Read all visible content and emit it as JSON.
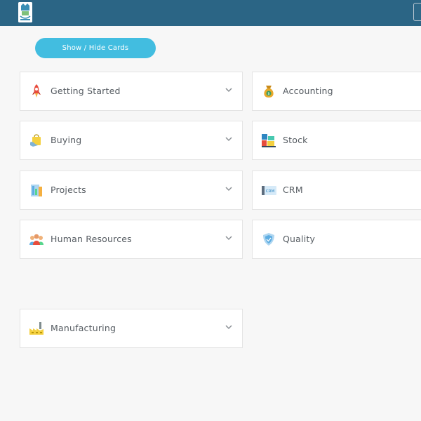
{
  "topbar": {
    "logo": "app-logo-icon",
    "menu_button": "menu-button"
  },
  "actions": {
    "show_hide_label": "Show / Hide Cards"
  },
  "cards": [
    {
      "label": "Getting Started",
      "icon": "rocket-icon",
      "column": "left",
      "expandable": true
    },
    {
      "label": "Accounting",
      "icon": "money-bag-icon",
      "column": "right",
      "expandable": false
    },
    {
      "label": "Buying",
      "icon": "shopping-bag-icon",
      "column": "left",
      "expandable": true
    },
    {
      "label": "Stock",
      "icon": "stock-boxes-icon",
      "column": "right",
      "expandable": false
    },
    {
      "label": "Projects",
      "icon": "projects-icon",
      "column": "left",
      "expandable": true
    },
    {
      "label": "CRM",
      "icon": "crm-icon",
      "column": "right",
      "expandable": false
    },
    {
      "label": "Human Resources",
      "icon": "people-icon",
      "column": "left",
      "expandable": true
    },
    {
      "label": "Quality",
      "icon": "shield-icon",
      "column": "right",
      "expandable": false
    },
    {
      "label": "Manufacturing",
      "icon": "factory-icon",
      "column": "left",
      "expandable": true
    }
  ],
  "colors": {
    "topbar": "#2b6585",
    "accent_button": "#42bde0",
    "background": "#f7f7f7",
    "card": "#ffffff",
    "text": "#555b61"
  }
}
